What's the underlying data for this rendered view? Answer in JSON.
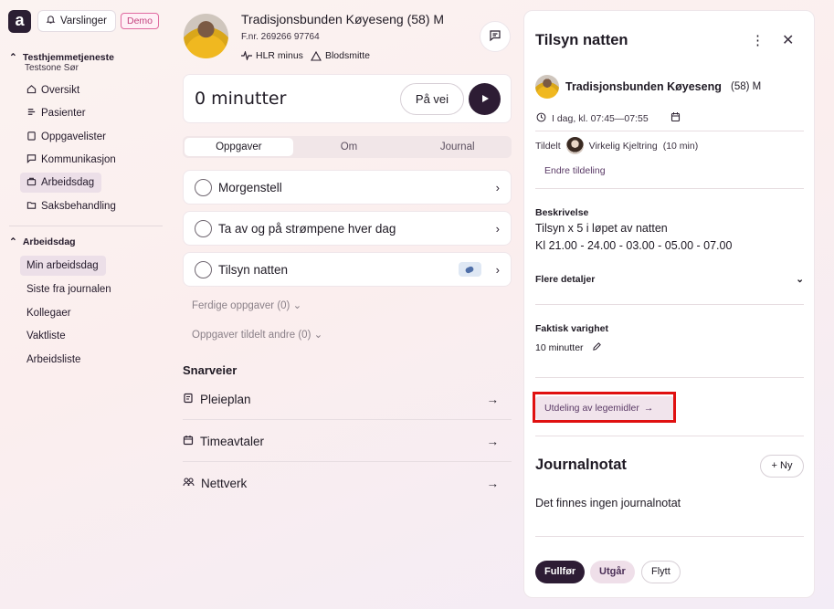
{
  "app": {
    "logo": "a"
  },
  "topbar": {
    "notifications_label": "Varslinger",
    "demo_badge": "Demo"
  },
  "sidebar": {
    "org_name": "Testhjemmetjeneste",
    "org_sub": "Testsone Sør",
    "items": [
      {
        "label": "Oversikt",
        "icon": "home-icon"
      },
      {
        "label": "Pasienter",
        "icon": "patients-icon"
      },
      {
        "label": "Oppgavelister",
        "icon": "clipboard-icon"
      },
      {
        "label": "Kommunikasjon",
        "icon": "message-icon"
      },
      {
        "label": "Arbeidsdag",
        "icon": "briefcase-icon"
      },
      {
        "label": "Saksbehandling",
        "icon": "folder-icon"
      }
    ],
    "section2_title": "Arbeidsdag",
    "section2_items": [
      {
        "label": "Min arbeidsdag"
      },
      {
        "label": "Siste fra journalen"
      },
      {
        "label": "Kollegaer"
      },
      {
        "label": "Vaktliste"
      },
      {
        "label": "Arbeidsliste"
      }
    ]
  },
  "patient": {
    "name": "Tradisjonsbunden Køyeseng (58) M",
    "fnr": "F.nr. 269266 97764",
    "tag1": "HLR minus",
    "tag2": "Blodsmitte"
  },
  "timer": {
    "text": "0 minutter",
    "onway_label": "På vei"
  },
  "tabs": [
    "Oppgaver",
    "Om",
    "Journal"
  ],
  "tasks": [
    {
      "label": "Morgenstell"
    },
    {
      "label": "Ta av og på strømpene hver dag"
    },
    {
      "label": "Tilsyn natten",
      "badge_icon": "pill-icon"
    }
  ],
  "collapsed": {
    "done": "Ferdige oppgaver (0)",
    "others": "Oppgaver tildelt andre (0)"
  },
  "shortcuts": {
    "title": "Snarveier",
    "items": [
      {
        "label": "Pleieplan",
        "icon": "care-plan-icon"
      },
      {
        "label": "Timeavtaler",
        "icon": "calendar-icon"
      },
      {
        "label": "Nettverk",
        "icon": "network-icon"
      }
    ]
  },
  "panel": {
    "title": "Tilsyn natten",
    "patient_name": "Tradisjonsbunden Køyeseng",
    "patient_age": "(58) M",
    "time": "I dag, kl. 07:45—07:55",
    "assigned_label": "Tildelt",
    "assigned_name": "Virkelig Kjeltring",
    "assigned_duration": "(10 min)",
    "edit_assignment": "Endre tildeling",
    "description_label": "Beskrivelse",
    "description_line1": "Tilsyn x 5 i løpet av natten",
    "description_line2": "Kl 21.00 - 24.00 - 03.00 - 05.00 - 07.00",
    "more_details": "Flere detaljer",
    "actual_duration_label": "Faktisk varighet",
    "actual_duration_value": "10 minutter",
    "med_button": "Utdeling av legemidler",
    "journal_title": "Journalnotat",
    "new_label": "Ny",
    "journal_empty": "Det finnes ingen journalnotat",
    "finish_label": "Fullfør",
    "expire_label": "Utgår",
    "move_label": "Flytt"
  },
  "colors": {
    "accent": "#2d1c34",
    "highlight": "#e01010"
  }
}
